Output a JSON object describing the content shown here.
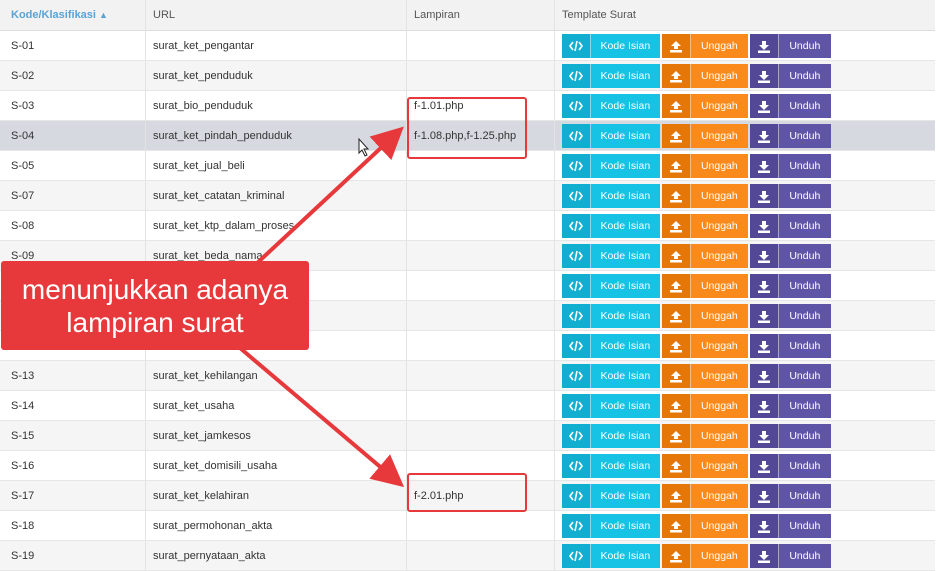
{
  "header": {
    "kode": "Kode/Klasifikasi",
    "sort_icon": "sort-icon",
    "url": "URL",
    "lampiran": "Lampiran",
    "template": "Template Surat"
  },
  "buttons": {
    "kode_isian": "Kode Isian",
    "unggah": "Unggah",
    "unduh": "Unduh"
  },
  "rows": [
    {
      "kode": "S-01",
      "url": "surat_ket_pengantar",
      "lampiran": ""
    },
    {
      "kode": "S-02",
      "url": "surat_ket_penduduk",
      "lampiran": ""
    },
    {
      "kode": "S-03",
      "url": "surat_bio_penduduk",
      "lampiran": "f-1.01.php"
    },
    {
      "kode": "S-04",
      "url": "surat_ket_pindah_penduduk",
      "lampiran": "f-1.08.php,f-1.25.php"
    },
    {
      "kode": "S-05",
      "url": "surat_ket_jual_beli",
      "lampiran": ""
    },
    {
      "kode": "S-07",
      "url": "surat_ket_catatan_kriminal",
      "lampiran": ""
    },
    {
      "kode": "S-08",
      "url": "surat_ket_ktp_dalam_proses",
      "lampiran": ""
    },
    {
      "kode": "S-09",
      "url": "surat_ket_beda_nama",
      "lampiran": ""
    },
    {
      "kode": "",
      "url": "",
      "lampiran": ""
    },
    {
      "kode": "",
      "url": "",
      "lampiran": ""
    },
    {
      "kode": "",
      "url": "",
      "lampiran": ""
    },
    {
      "kode": "S-13",
      "url": "surat_ket_kehilangan",
      "lampiran": ""
    },
    {
      "kode": "S-14",
      "url": "surat_ket_usaha",
      "lampiran": ""
    },
    {
      "kode": "S-15",
      "url": "surat_ket_jamkesos",
      "lampiran": ""
    },
    {
      "kode": "S-16",
      "url": "surat_ket_domisili_usaha",
      "lampiran": ""
    },
    {
      "kode": "S-17",
      "url": "surat_ket_kelahiran",
      "lampiran": "f-2.01.php"
    },
    {
      "kode": "S-18",
      "url": "surat_permohonan_akta",
      "lampiran": ""
    },
    {
      "kode": "S-19",
      "url": "surat_pernyataan_akta",
      "lampiran": ""
    }
  ],
  "highlighted_row": 3,
  "annotation": {
    "line1": "menunjukkan adanya",
    "line2": "lampiran surat",
    "color": "#e7393b"
  },
  "colors": {
    "kode_isian": "#17c3e5",
    "unggah": "#fb8a1c",
    "unduh": "#5f55a7"
  }
}
